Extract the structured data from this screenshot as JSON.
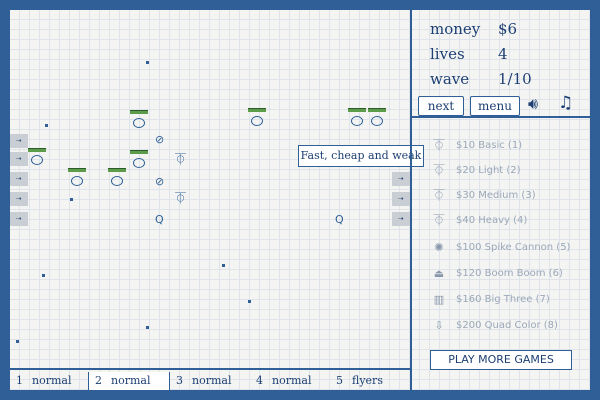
{
  "stats": {
    "money_label": "money",
    "money_value": "$6",
    "lives_label": "lives",
    "lives_value": "4",
    "wave_label": "wave",
    "wave_value": "1/10"
  },
  "buttons": {
    "next": "next",
    "menu": "menu",
    "sound_icon": "speaker-icon",
    "music_icon": "music-notes-icon"
  },
  "tooltip": "Fast, cheap and weak",
  "towers": [
    {
      "icon": "basic-tower-icon",
      "label": "$10 Basic (1)"
    },
    {
      "icon": "light-tower-icon",
      "label": "$20 Light (2)"
    },
    {
      "icon": "medium-tower-icon",
      "label": "$30 Medium (3)"
    },
    {
      "icon": "heavy-tower-icon",
      "label": "$40 Heavy (4)"
    },
    {
      "icon": "spike-cannon-icon",
      "label": "$100 Spike Cannon (5)"
    },
    {
      "icon": "boom-boom-icon",
      "label": "$120 Boom Boom (6)"
    },
    {
      "icon": "big-three-icon",
      "label": "$160 Big Three (7)"
    },
    {
      "icon": "quad-color-icon",
      "label": "$200 Quad Color (8)"
    }
  ],
  "play_more": "PLAY MORE GAMES",
  "waves": [
    {
      "num": "1",
      "type": "normal"
    },
    {
      "num": "2",
      "type": "normal"
    },
    {
      "num": "3",
      "type": "normal"
    },
    {
      "num": "4",
      "type": "normal"
    },
    {
      "num": "5",
      "type": "flyers"
    }
  ],
  "lane_marker": "→",
  "colors": {
    "ink": "#2f5f96",
    "health": "#5b9b49",
    "paper": "#f4f5f3"
  }
}
